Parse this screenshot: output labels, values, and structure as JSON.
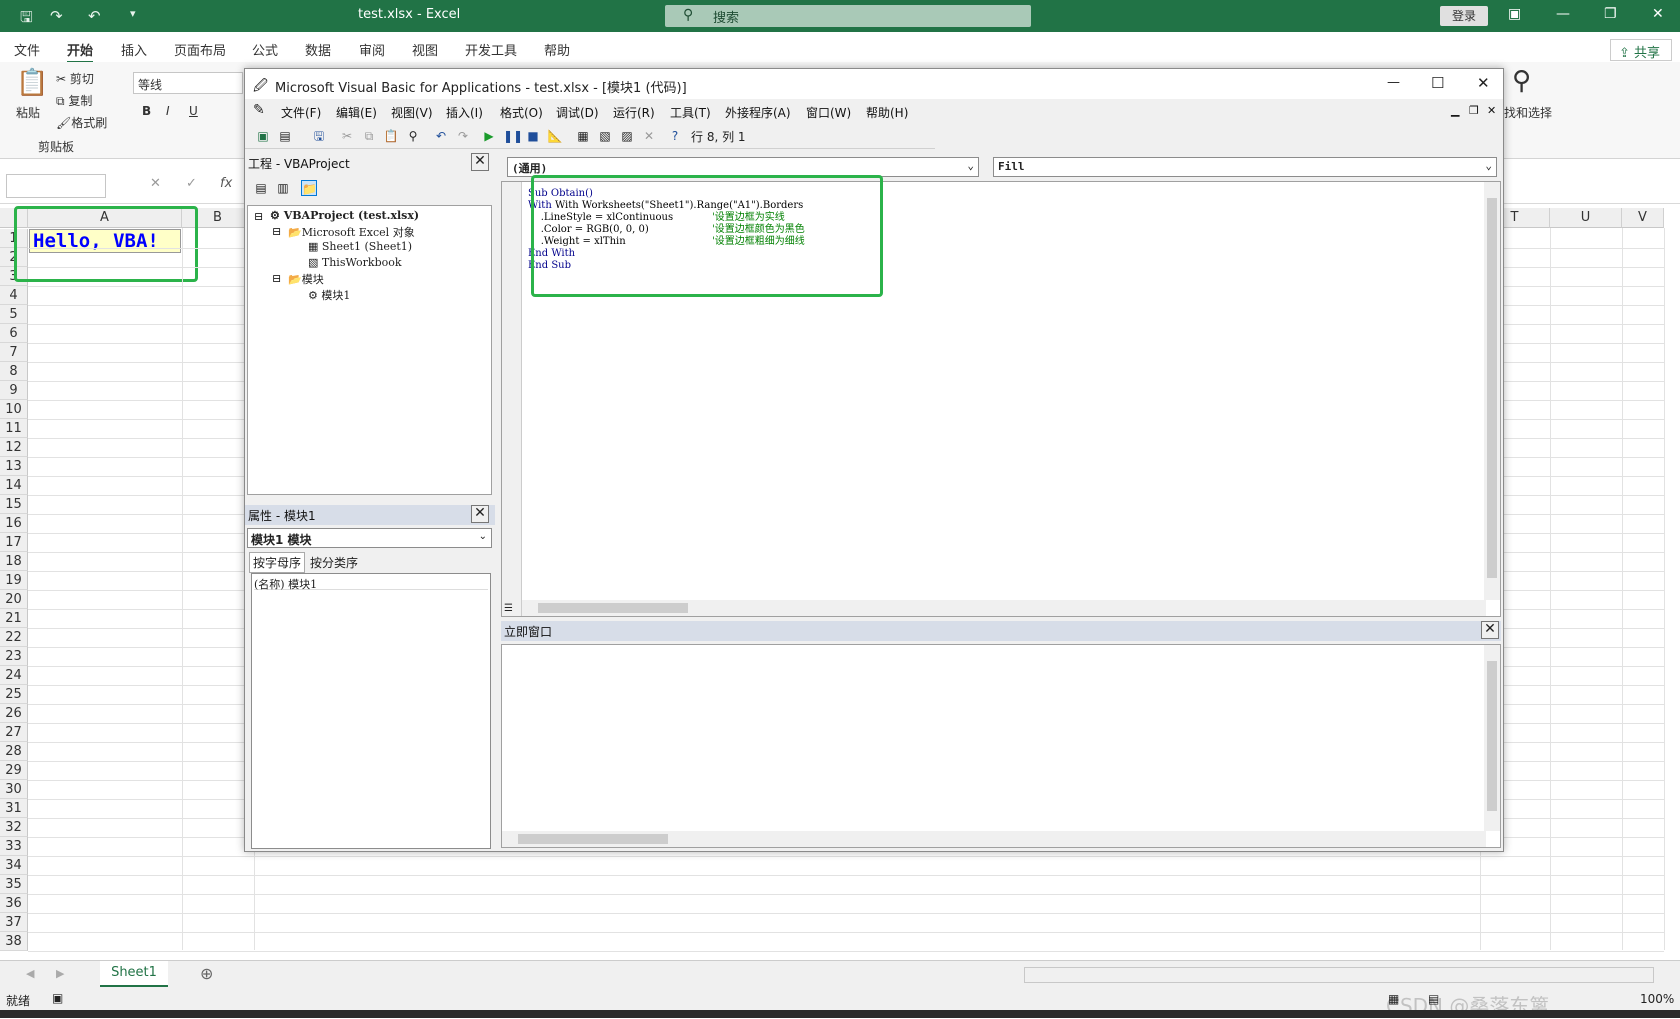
{
  "excel": {
    "title": "test.xlsx  -  Excel",
    "search_placeholder": "搜索",
    "login": "登录",
    "share": "共享",
    "tabs": [
      "文件",
      "开始",
      "插入",
      "页面布局",
      "公式",
      "数据",
      "审阅",
      "视图",
      "开发工具",
      "帮助"
    ],
    "active_tab": "开始",
    "ribbon": {
      "paste": "粘贴",
      "cut": "剪切",
      "copy": "复制",
      "format_painter": "格式刷",
      "clipboard_group": "剪贴板",
      "font_name": "等线",
      "bold": "B",
      "italic": "I",
      "underline": "U",
      "find_select": "找和选择"
    },
    "fx": "fx",
    "columns_left": [
      "A",
      "B"
    ],
    "columns_right": [
      "T",
      "U",
      "V"
    ],
    "rows": [
      "1",
      "2",
      "3",
      "4",
      "5",
      "6",
      "7",
      "8",
      "9",
      "10",
      "11",
      "12",
      "13",
      "14",
      "15",
      "16",
      "17",
      "18",
      "19",
      "20",
      "21",
      "22",
      "23",
      "24",
      "25",
      "26",
      "27",
      "28",
      "29",
      "30",
      "31",
      "32",
      "33",
      "34",
      "35",
      "36",
      "37",
      "38"
    ],
    "cell_a1": "Hello, VBA!",
    "sheet_tab": "Sheet1",
    "status": "就绪",
    "zoom": "100%",
    "watermark": "CSDN @桑落东篱"
  },
  "vbe": {
    "title": "Microsoft Visual Basic for Applications - test.xlsx - [模块1 (代码)]",
    "menu": [
      "文件(F)",
      "编辑(E)",
      "视图(V)",
      "插入(I)",
      "格式(O)",
      "调试(D)",
      "运行(R)",
      "工具(T)",
      "外接程序(A)",
      "窗口(W)",
      "帮助(H)"
    ],
    "position": "行 8, 列 1",
    "project_header": "工程 - VBAProject",
    "tree": {
      "root": "VBAProject (test.xlsx)",
      "excel_objects": "Microsoft Excel 对象",
      "sheet1": "Sheet1 (Sheet1)",
      "thisworkbook": "ThisWorkbook",
      "modules": "模块",
      "module1": "模块1"
    },
    "props_header": "属性 - 模块1",
    "props_object": "模块1 模块",
    "props_tab_alpha": "按字母序",
    "props_tab_cat": "按分类序",
    "props_row": "(名称) 模块1",
    "combo_general": "(通用)",
    "combo_proc": "Fill",
    "immediate_header": "立即窗口",
    "code": {
      "l1": "Sub Obtain()",
      "l2": "With Worksheets(\"Sheet1\").Range(\"A1\").Borders",
      "l3": "    .LineStyle = xlContinuous",
      "l3c": "'设置边框为实线",
      "l4": "    .Color = RGB(0, 0, 0)",
      "l4c": "'设置边框颜色为黑色",
      "l5": "    .Weight = xlThin",
      "l5c": "'设置边框粗细为细线",
      "l6": "End With",
      "l7": "End Sub"
    }
  }
}
